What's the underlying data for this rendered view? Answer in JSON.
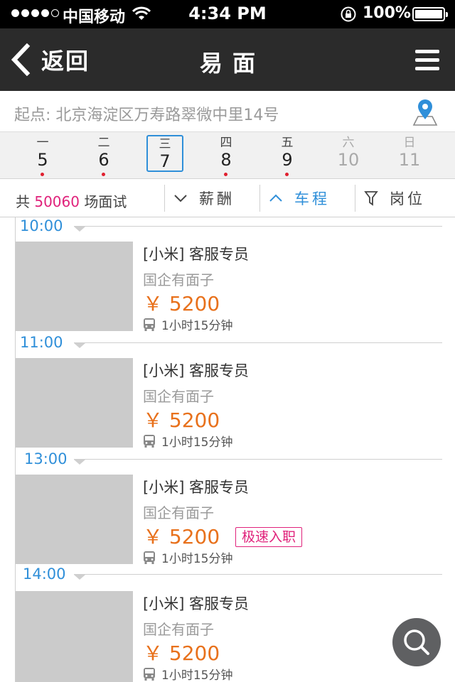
{
  "status_bar": {
    "carrier": "中国移动",
    "time": "4:34 PM",
    "battery": "100%"
  },
  "nav": {
    "back_label": "返回",
    "title": "易面"
  },
  "start": {
    "text": "起点: 北京海淀区万寿路翠微中里14号"
  },
  "dates": [
    {
      "weekday": "一",
      "day": "5",
      "has_dot": true,
      "muted": false,
      "selected": false
    },
    {
      "weekday": "二",
      "day": "6",
      "has_dot": true,
      "muted": false,
      "selected": false
    },
    {
      "weekday": "三",
      "day": "7",
      "has_dot": false,
      "muted": false,
      "selected": true
    },
    {
      "weekday": "四",
      "day": "8",
      "has_dot": true,
      "muted": false,
      "selected": false
    },
    {
      "weekday": "五",
      "day": "9",
      "has_dot": true,
      "muted": false,
      "selected": false
    },
    {
      "weekday": "六",
      "day": "10",
      "has_dot": false,
      "muted": true,
      "selected": false
    },
    {
      "weekday": "日",
      "day": "11",
      "has_dot": false,
      "muted": true,
      "selected": false
    }
  ],
  "filter": {
    "total_prefix": "共",
    "total_count": "50060",
    "total_suffix": "场面试",
    "salary": "薪酬",
    "commute": "车程",
    "position": "岗位"
  },
  "slots": [
    {
      "time": "10:00",
      "job": {
        "title": "[小米] 客服专员",
        "company": "国企有面子",
        "salary": "￥ 5200",
        "badge": "",
        "commute": "1小时15分钟"
      }
    },
    {
      "time": "11:00",
      "job": {
        "title": "[小米] 客服专员",
        "company": "国企有面子",
        "salary": "￥ 5200",
        "badge": "",
        "commute": "1小时15分钟"
      }
    },
    {
      "time": "13:00",
      "job": {
        "title": "[小米] 客服专员",
        "company": "国企有面子",
        "salary": "￥ 5200",
        "badge": "极速入职",
        "commute": "1小时15分钟"
      }
    },
    {
      "time": "14:00",
      "job": {
        "title": "[小米] 客服专员",
        "company": "国企有面子",
        "salary": "￥ 5200",
        "badge": "",
        "commute": "1小时15分钟"
      }
    }
  ],
  "colors": {
    "accent": "#2f8fd9",
    "salary": "#e8711c",
    "badge": "#e0227b",
    "nav_bg": "#2b2b2b"
  },
  "icons": [
    "back-chevron-icon",
    "menu-icon",
    "location-pin-icon",
    "chevron-down-icon",
    "chevron-up-icon",
    "filter-funnel-icon",
    "bus-icon",
    "search-icon"
  ]
}
